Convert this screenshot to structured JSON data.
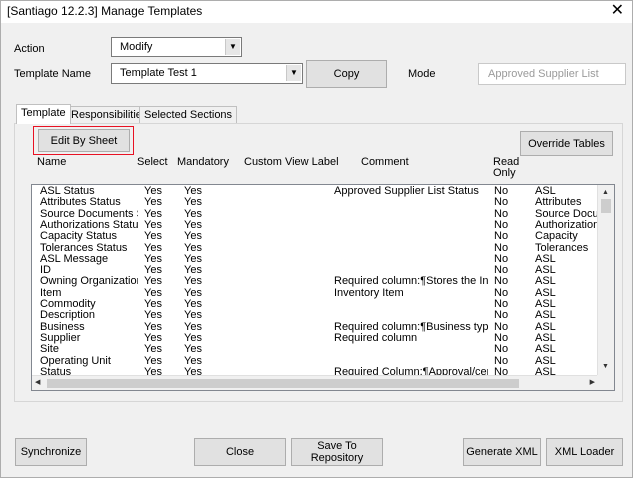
{
  "window": {
    "title": "[Santiago 12.2.3] Manage Templates",
    "close_glyph": "✕"
  },
  "action": {
    "label": "Action",
    "value": "Modify"
  },
  "template_name": {
    "label": "Template Name",
    "value": "Template Test 1"
  },
  "copy_button": "Copy",
  "mode": {
    "label": "Mode",
    "value": "Approved Supplier List"
  },
  "tabs": [
    {
      "label": "Template",
      "active": true
    },
    {
      "label": "Responsibilities",
      "active": false
    },
    {
      "label": "Selected Sections",
      "active": false
    }
  ],
  "edit_by_sheet_button": "Edit By Sheet",
  "override_tables_button": "Override Tables",
  "columns": {
    "name": "Name",
    "select": "Select",
    "mandatory": "Mandatory",
    "custom_view_label": "Custom View Label",
    "comment": "Comment",
    "read_only_1": "Read",
    "read_only_2": "Only"
  },
  "rows": [
    {
      "name": "ASL Status",
      "select": "Yes",
      "mandatory": "Yes",
      "comment": "Approved Supplier List Status",
      "read_only": "No",
      "section": "ASL"
    },
    {
      "name": "Attributes Status",
      "select": "Yes",
      "mandatory": "Yes",
      "comment": "",
      "read_only": "No",
      "section": "Attributes"
    },
    {
      "name": "Source Documents Stat",
      "select": "Yes",
      "mandatory": "Yes",
      "comment": "",
      "read_only": "No",
      "section": "Source Docume"
    },
    {
      "name": "Authorizations Status",
      "select": "Yes",
      "mandatory": "Yes",
      "comment": "",
      "read_only": "No",
      "section": "Authorizations"
    },
    {
      "name": "Capacity Status",
      "select": "Yes",
      "mandatory": "Yes",
      "comment": "",
      "read_only": "No",
      "section": "Capacity"
    },
    {
      "name": "Tolerances Status",
      "select": "Yes",
      "mandatory": "Yes",
      "comment": "",
      "read_only": "No",
      "section": "Tolerances"
    },
    {
      "name": "ASL Message",
      "select": "Yes",
      "mandatory": "Yes",
      "comment": "",
      "read_only": "No",
      "section": "ASL"
    },
    {
      "name": "ID",
      "select": "Yes",
      "mandatory": "Yes",
      "comment": "",
      "read_only": "No",
      "section": "ASL"
    },
    {
      "name": "Owning Organization",
      "select": "Yes",
      "mandatory": "Yes",
      "comment": "Required column:¶Stores the Invento",
      "read_only": "No",
      "section": "ASL"
    },
    {
      "name": "Item",
      "select": "Yes",
      "mandatory": "Yes",
      "comment": "Inventory Item",
      "read_only": "No",
      "section": "ASL"
    },
    {
      "name": "Commodity",
      "select": "Yes",
      "mandatory": "Yes",
      "comment": "",
      "read_only": "No",
      "section": "ASL"
    },
    {
      "name": "Description",
      "select": "Yes",
      "mandatory": "Yes",
      "comment": "",
      "read_only": "No",
      "section": "ASL"
    },
    {
      "name": "Business",
      "select": "Yes",
      "mandatory": "Yes",
      "comment": "Required column:¶Business type of D",
      "read_only": "No",
      "section": "ASL"
    },
    {
      "name": "Supplier",
      "select": "Yes",
      "mandatory": "Yes",
      "comment": "Required column",
      "read_only": "No",
      "section": "ASL"
    },
    {
      "name": "Site",
      "select": "Yes",
      "mandatory": "Yes",
      "comment": "",
      "read_only": "No",
      "section": "ASL"
    },
    {
      "name": "Operating Unit",
      "select": "Yes",
      "mandatory": "Yes",
      "comment": "",
      "read_only": "No",
      "section": "ASL"
    },
    {
      "name": "Status",
      "select": "Yes",
      "mandatory": "Yes",
      "comment": "Required Column:¶Approval/certifica",
      "read_only": "No",
      "section": "ASL"
    }
  ],
  "buttons": {
    "synchronize": "Synchronize",
    "close": "Close",
    "save_to_repository": "Save To Repository",
    "generate_xml": "Generate XML",
    "xml_loader": "XML Loader"
  },
  "colors": {
    "highlight_border": "#e81123",
    "window_bg": "#f0f0f0"
  }
}
